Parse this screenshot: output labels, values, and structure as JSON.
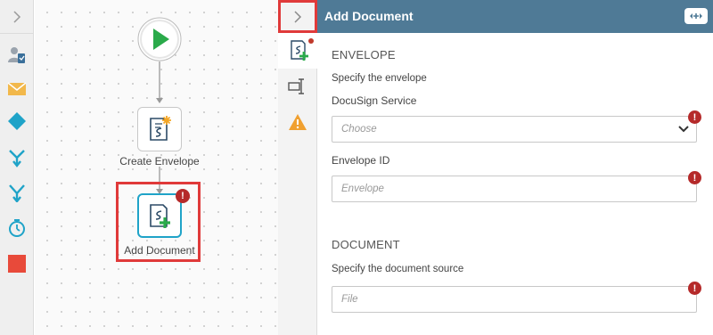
{
  "panel": {
    "title": "Add Document"
  },
  "workflow": {
    "nodes": [
      {
        "label": "Create Envelope"
      },
      {
        "label": "Add Document"
      }
    ]
  },
  "palette": {
    "items": [
      "user-task-icon",
      "email-icon",
      "decision-icon",
      "merge-icon",
      "split-icon",
      "timer-icon",
      "stop-icon"
    ]
  },
  "form": {
    "envelope": {
      "section": "ENVELOPE",
      "hint": "Specify the envelope",
      "service_label": "DocuSign Service",
      "service_placeholder": "Choose",
      "id_label": "Envelope ID",
      "id_placeholder": "Envelope"
    },
    "document": {
      "section": "DOCUMENT",
      "hint": "Specify the document source",
      "file_placeholder": "File"
    }
  },
  "colors": {
    "header": "#4f7a96",
    "accent_green": "#2aaa4a",
    "error": "#b52a2a",
    "highlight": "#e03a3a"
  }
}
